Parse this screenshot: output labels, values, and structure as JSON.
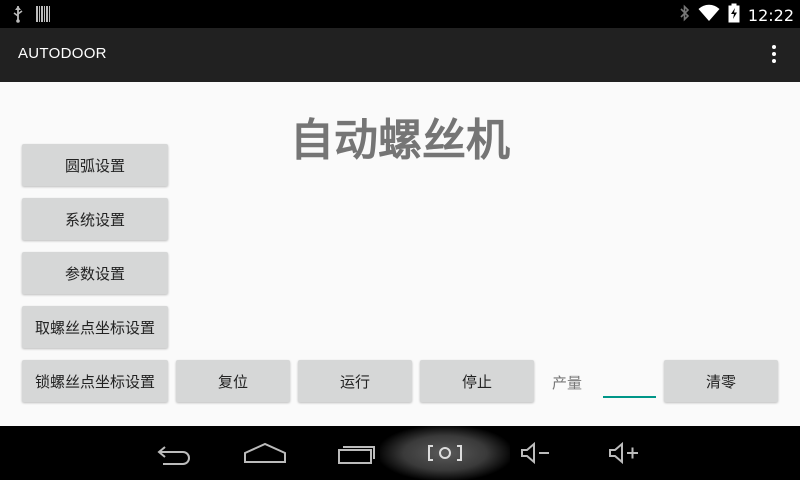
{
  "status_bar": {
    "time": "12:22",
    "icons": [
      "usb-icon",
      "barcode-icon",
      "bluetooth-icon",
      "wifi-icon",
      "battery-charging-icon"
    ]
  },
  "action_bar": {
    "title": "AUTODOOR",
    "overflow_icon": "overflow-menu-icon"
  },
  "main": {
    "title": "自动螺丝机",
    "buttons": {
      "arc_settings": "圆弧设置",
      "system_settings": "系统设置",
      "parameter_settings": "参数设置",
      "pick_screw_coords": "取螺丝点坐标设置",
      "lock_screw_coords": "锁螺丝点坐标设置",
      "reset": "复位",
      "run": "运行",
      "stop": "停止",
      "clear": "清零"
    },
    "output_label": "产量",
    "output_value": ""
  },
  "nav_bar": {
    "icons": [
      "back-icon",
      "home-icon",
      "recents-icon",
      "screenshot-icon",
      "volume-down-icon",
      "volume-up-icon"
    ]
  },
  "colors": {
    "accent": "#009688",
    "button_bg": "#d6d7d7",
    "title_text": "#757575"
  }
}
